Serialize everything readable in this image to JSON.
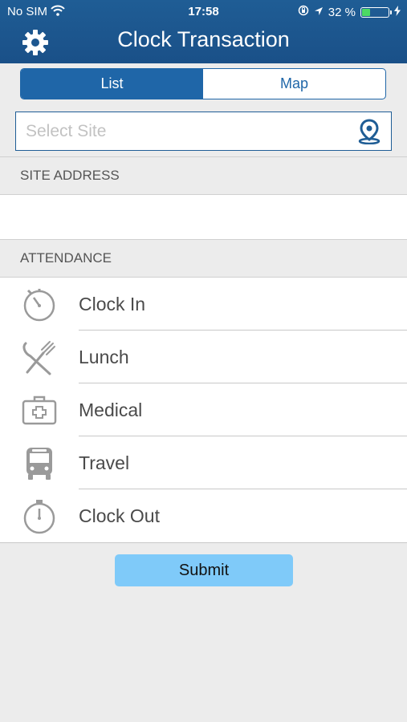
{
  "status_bar": {
    "carrier": "No SIM",
    "time": "17:58",
    "battery": "32 %",
    "battery_level": 0.32,
    "icons": [
      "wifi-icon",
      "orientation-lock-icon",
      "location-arrow-icon",
      "battery-icon",
      "charging-bolt-icon"
    ]
  },
  "header": {
    "title": "Clock Transaction",
    "settings_icon": "gear-icon",
    "color": "#1f5d95"
  },
  "segmented": {
    "list": "List",
    "map": "Map",
    "selected": "List"
  },
  "site": {
    "placeholder": "Select Site",
    "value": "",
    "icon": "location-pin-icon"
  },
  "sections": {
    "site_address": "SITE ADDRESS",
    "attendance": "ATTENDANCE"
  },
  "attendance": [
    {
      "label": "Clock In",
      "icon": "stopwatch-icon"
    },
    {
      "label": "Lunch",
      "icon": "fork-knife-icon"
    },
    {
      "label": "Medical",
      "icon": "first-aid-kit-icon"
    },
    {
      "label": "Travel",
      "icon": "bus-icon"
    },
    {
      "label": "Clock Out",
      "icon": "stopwatch-icon"
    }
  ],
  "submit": {
    "label": "Submit",
    "color": "#7fcaf9"
  }
}
